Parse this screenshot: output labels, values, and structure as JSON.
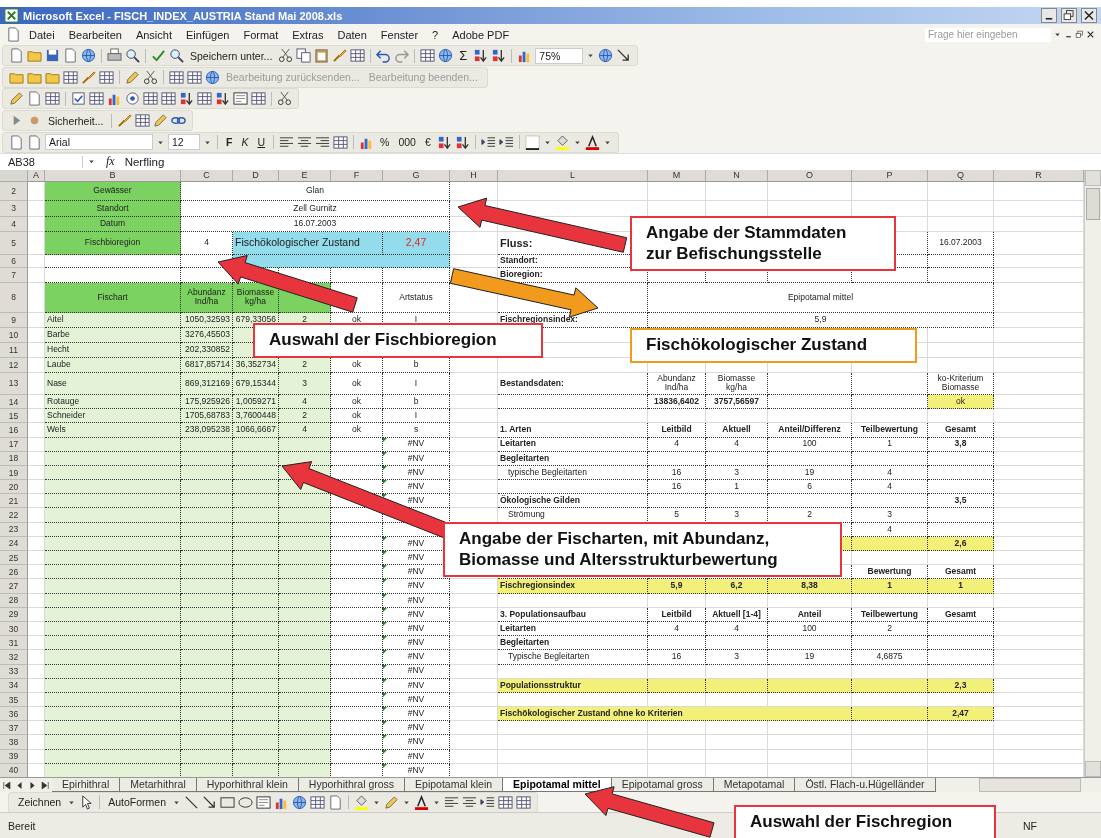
{
  "window": {
    "title": "Microsoft Excel - FISCH_INDEX_AUSTRIA Stand Mai 2008.xls"
  },
  "menu": [
    "Datei",
    "Bearbeiten",
    "Ansicht",
    "Einfügen",
    "Format",
    "Extras",
    "Daten",
    "Fenster",
    "?",
    "Adobe PDF"
  ],
  "help_field": {
    "placeholder": "Frage hier eingeben"
  },
  "toolbars": {
    "standard": {
      "save_as": "Speichern unter...",
      "autosum": "Σ",
      "zoom": "75%"
    },
    "review": [
      {
        "label": "Bearbeitung zurücksenden...",
        "disabled": true
      },
      {
        "label": "Bearbeitung beenden...",
        "disabled": true
      }
    ],
    "security": "Sicherheit...",
    "formatting": {
      "font": "Arial",
      "size": "12",
      "bold": "F",
      "italic": "K",
      "underline": "U",
      "percent": "%",
      "thousands": "000",
      "currency": "€"
    }
  },
  "formula_bar": {
    "name_box": "AB38",
    "fx": "fx",
    "content": "Nerfling"
  },
  "sheet": {
    "columns": [
      "A",
      "B",
      "C",
      "D",
      "E",
      "F",
      "G",
      "H",
      "L",
      "M",
      "N",
      "O",
      "P",
      "Q",
      "R"
    ],
    "rows": [
      {
        "number": "2",
        "cells": {
          "B": {
            "text": "Gewässer",
            "kind": "label"
          },
          "C:G": "Glan"
        }
      },
      {
        "number": "3",
        "cells": {
          "B": {
            "text": "Standort",
            "kind": "label"
          },
          "C:G": "Zell Gurnitz"
        }
      },
      {
        "number": "4",
        "cells": {
          "B": {
            "text": "Datum",
            "kind": "label"
          },
          "C:G": "16.07.2003"
        }
      },
      {
        "number": "5",
        "cells": {
          "B": {
            "text": "Fischbioregion",
            "kind": "label"
          },
          "C": "4",
          "D:F": {
            "text": "Fischökologischer Zustand",
            "kind": "result"
          },
          "G": {
            "text": "2,47",
            "kind": "result_value"
          },
          "L": {
            "text": "Fluss:",
            "kind": "title"
          },
          "Q": "16.07.2003"
        }
      },
      {
        "number": "6",
        "cells": {
          "D:G": {
            "kind": "result"
          },
          "L": {
            "text": "Standort:",
            "kind": "heading"
          }
        }
      },
      {
        "number": "7",
        "cells": {
          "L": {
            "text": "Bioregion:",
            "kind": "heading"
          }
        }
      },
      {
        "number": "8",
        "cells": {
          "B": {
            "text": "Fischart",
            "kind": "label"
          },
          "C": {
            "text": "Abundanz Ind/ha",
            "kind": "label"
          },
          "D": {
            "text": "Biomasse kg/ha",
            "kind": "label"
          },
          "E": {
            "kind": "label"
          },
          "G": "Artstatus",
          "M:Q": "Epipotamal mittel"
        }
      },
      {
        "number": "9",
        "cells": {
          "B": "Aitel",
          "C": {
            "text": "1050,32593",
            "kind": "number"
          },
          "D": {
            "text": "679,33056",
            "kind": "number"
          },
          "E": "2",
          "F": "ok",
          "G": "I",
          "L": {
            "text": "Fischregionsindex:",
            "kind": "heading"
          },
          "M:Q": "5,9"
        }
      },
      {
        "number": "10",
        "cells": {
          "B": "Barbe",
          "C": {
            "text": "3276,45503",
            "kind": "number"
          }
        }
      },
      {
        "number": "11",
        "cells": {
          "B": "Hecht",
          "C": {
            "text": "202,330852",
            "kind": "number"
          }
        }
      },
      {
        "number": "12",
        "cells": {
          "B": "Laube",
          "C": {
            "text": "6817,85714",
            "kind": "number"
          },
          "D": {
            "text": "36,352734",
            "kind": "number"
          },
          "E": "2",
          "F": "ok",
          "G": "b"
        }
      },
      {
        "number": "13",
        "cells": {
          "B": "Nase",
          "C": {
            "text": "869,312169",
            "kind": "number"
          },
          "D": {
            "text": "679,15344",
            "kind": "number"
          },
          "E": "3",
          "F": "ok",
          "G": "I",
          "L": {
            "text": "Bestandsdaten:",
            "kind": "heading"
          },
          "M": "Abundanz Ind/ha",
          "N": "Biomasse kg/ha",
          "Q": "ko-Kriterium Biomasse"
        }
      },
      {
        "number": "14",
        "cells": {
          "B": "Rotauge",
          "C": {
            "text": "175,925926",
            "kind": "number"
          },
          "D": {
            "text": "1,0059271",
            "kind": "number"
          },
          "E": "4",
          "F": "ok",
          "G": "b",
          "M": {
            "text": "13836,6402",
            "kind": "heading"
          },
          "N": {
            "text": "3757,56597",
            "kind": "heading"
          },
          "Q": {
            "text": "ok",
            "kind": "flag"
          }
        }
      },
      {
        "number": "15",
        "cells": {
          "B": "Schneider",
          "C": {
            "text": "1705,68783",
            "kind": "number"
          },
          "D": {
            "text": "3,7600448",
            "kind": "number"
          },
          "E": "2",
          "F": "ok",
          "G": "I"
        }
      },
      {
        "number": "16",
        "cells": {
          "B": "Wels",
          "C": {
            "text": "238,095238",
            "kind": "number"
          },
          "D": {
            "text": "1066,6667",
            "kind": "number"
          },
          "E": "4",
          "F": "ok",
          "G": "s",
          "L": {
            "text": "1. Arten",
            "kind": "heading"
          },
          "M": {
            "text": "Leitbild",
            "kind": "heading"
          },
          "N": {
            "text": "Aktuell",
            "kind": "heading"
          },
          "O": {
            "text": "Anteil/Differenz",
            "kind": "heading"
          },
          "P": {
            "text": "Teilbewertung",
            "kind": "heading"
          },
          "Q": {
            "text": "Gesamt",
            "kind": "heading"
          }
        }
      },
      {
        "number": "17",
        "cells": {
          "G": {
            "text": "#NV",
            "kind": "error"
          },
          "L": {
            "text": "Leitarten",
            "kind": "heading"
          },
          "M": "4",
          "N": "4",
          "O": "100",
          "P": "1",
          "Q": {
            "text": "3,8",
            "kind": "heading"
          }
        }
      },
      {
        "number": "18",
        "cells": {
          "G": {
            "text": "#NV",
            "kind": "error"
          },
          "L": {
            "text": "Begleitarten",
            "kind": "heading"
          }
        }
      },
      {
        "number": "19",
        "cells": {
          "G": {
            "text": "#NV",
            "kind": "error"
          },
          "L": {
            "text": "typische Begleitarten",
            "kind": "indent"
          },
          "M": "16",
          "N": "3",
          "O": "19",
          "P": "4"
        }
      },
      {
        "number": "20",
        "cells": {
          "G": {
            "text": "#NV",
            "kind": "error"
          },
          "M": "16",
          "N": "1",
          "O": "6",
          "P": "4"
        }
      },
      {
        "number": "21",
        "cells": {
          "G": {
            "text": "#NV",
            "kind": "error"
          },
          "L": {
            "text": "Ökologische Gilden",
            "kind": "heading"
          },
          "Q": {
            "text": "3,5",
            "kind": "heading"
          }
        }
      },
      {
        "number": "22",
        "cells": {
          "L": {
            "text": "Strömung",
            "kind": "indent"
          },
          "M": "5",
          "N": "3",
          "O": "2",
          "P": "3"
        }
      },
      {
        "number": "23",
        "cells": {
          "P": "4"
        }
      },
      {
        "number": "24",
        "cells": {
          "G": {
            "text": "#NV",
            "kind": "error"
          },
          "P": {
            "kind": "total"
          },
          "Q": {
            "text": "2,6",
            "kind": "total"
          }
        }
      },
      {
        "number": "25",
        "cells": {
          "G": {
            "text": "#NV",
            "kind": "error"
          }
        }
      },
      {
        "number": "26",
        "cells": {
          "G": {
            "text": "#NV",
            "kind": "error"
          },
          "P": {
            "text": "Bewertung",
            "kind": "heading"
          },
          "Q": {
            "text": "Gesamt",
            "kind": "heading"
          }
        }
      },
      {
        "number": "27",
        "cells": {
          "G": {
            "text": "#NV",
            "kind": "error"
          },
          "L": {
            "text": "Fischregionsindex",
            "kind": "total"
          },
          "M": {
            "text": "5,9",
            "kind": "total"
          },
          "N": {
            "text": "6,2",
            "kind": "total"
          },
          "O": {
            "text": "8,38",
            "kind": "total"
          },
          "P": {
            "text": "1",
            "kind": "total"
          },
          "Q": {
            "text": "1",
            "kind": "total"
          }
        }
      },
      {
        "number": "28",
        "cells": {
          "G": {
            "text": "#NV",
            "kind": "error"
          }
        }
      },
      {
        "number": "29",
        "cells": {
          "G": {
            "text": "#NV",
            "kind": "error"
          },
          "L": {
            "text": "3. Populationsaufbau",
            "kind": "heading"
          },
          "M": {
            "text": "Leitbild",
            "kind": "heading"
          },
          "N": {
            "text": "Aktuell [1-4]",
            "kind": "heading"
          },
          "O": {
            "text": "Anteil",
            "kind": "heading"
          },
          "P": {
            "text": "Teilbewertung",
            "kind": "heading"
          },
          "Q": {
            "text": "Gesamt",
            "kind": "heading"
          }
        }
      },
      {
        "number": "30",
        "cells": {
          "G": {
            "text": "#NV",
            "kind": "error"
          },
          "L": {
            "text": "Leitarten",
            "kind": "heading"
          },
          "M": "4",
          "N": "4",
          "O": "100",
          "P": "2"
        }
      },
      {
        "number": "31",
        "cells": {
          "G": {
            "text": "#NV",
            "kind": "error"
          },
          "L": {
            "text": "Begleitarten",
            "kind": "heading"
          }
        }
      },
      {
        "number": "32",
        "cells": {
          "G": {
            "text": "#NV",
            "kind": "error"
          },
          "L": {
            "text": "Typische Begleitarten",
            "kind": "indent"
          },
          "M": "16",
          "N": "3",
          "O": "19",
          "P": "4,6875"
        }
      },
      {
        "number": "33",
        "cells": {
          "G": {
            "text": "#NV",
            "kind": "error"
          }
        }
      },
      {
        "number": "34",
        "cells": {
          "G": {
            "text": "#NV",
            "kind": "error"
          },
          "L": {
            "text": "Populationsstruktur",
            "kind": "total"
          },
          "Q": {
            "text": "2,3",
            "kind": "total"
          }
        }
      },
      {
        "number": "35",
        "cells": {
          "G": {
            "text": "#NV",
            "kind": "error"
          }
        }
      },
      {
        "number": "36",
        "cells": {
          "G": {
            "text": "#NV",
            "kind": "error"
          },
          "L:O": {
            "text": "Fischökologischer Zustand ohne ko Kriterien",
            "kind": "total"
          },
          "Q": {
            "text": "2,47",
            "kind": "total"
          }
        }
      },
      {
        "number": "37",
        "cells": {
          "G": {
            "text": "#NV",
            "kind": "error"
          }
        }
      },
      {
        "number": "38",
        "cells": {
          "G": {
            "text": "#NV",
            "kind": "error"
          }
        }
      },
      {
        "number": "39",
        "cells": {
          "G": {
            "text": "#NV",
            "kind": "error"
          }
        }
      },
      {
        "number": "40",
        "cells": {
          "G": {
            "text": "#NV",
            "kind": "error"
          }
        }
      }
    ]
  },
  "sheet_tabs": [
    {
      "label": "Epirhithral",
      "selected": false
    },
    {
      "label": "Metarhithral",
      "selected": false
    },
    {
      "label": "Hyporhithral klein",
      "selected": false
    },
    {
      "label": "Hyporhithral gross",
      "selected": false
    },
    {
      "label": "Epipotamal klein",
      "selected": false
    },
    {
      "label": "Epipotamal mittel",
      "selected": true
    },
    {
      "label": "Epipotamal gross",
      "selected": false
    },
    {
      "label": "Metapotamal",
      "selected": false
    },
    {
      "label": "Östl. Flach-u.Hügelländer",
      "selected": false
    }
  ],
  "drawing_toolbar": {
    "draw": "Zeichnen",
    "autoshapes": "AutoFormen"
  },
  "status_bar": {
    "left": "Bereit",
    "right": "NF"
  },
  "annotations": [
    {
      "lines": [
        "Angabe der Stammdaten",
        "zur Befischungsstelle"
      ],
      "color": "#e8343c"
    },
    {
      "lines": [
        "Auswahl der Fischbioregion"
      ],
      "color": "#e8343c"
    },
    {
      "lines": [
        "Fischökologischer Zustand"
      ],
      "color": "#f29a1e"
    },
    {
      "lines": [
        "Angabe der Fischarten, mit Abundanz,",
        "Biomasse und Altersstrukturbewertung"
      ],
      "color": "#e8343c"
    },
    {
      "lines": [
        "Auswahl der Fischregion"
      ],
      "color": "#e8343c"
    }
  ]
}
